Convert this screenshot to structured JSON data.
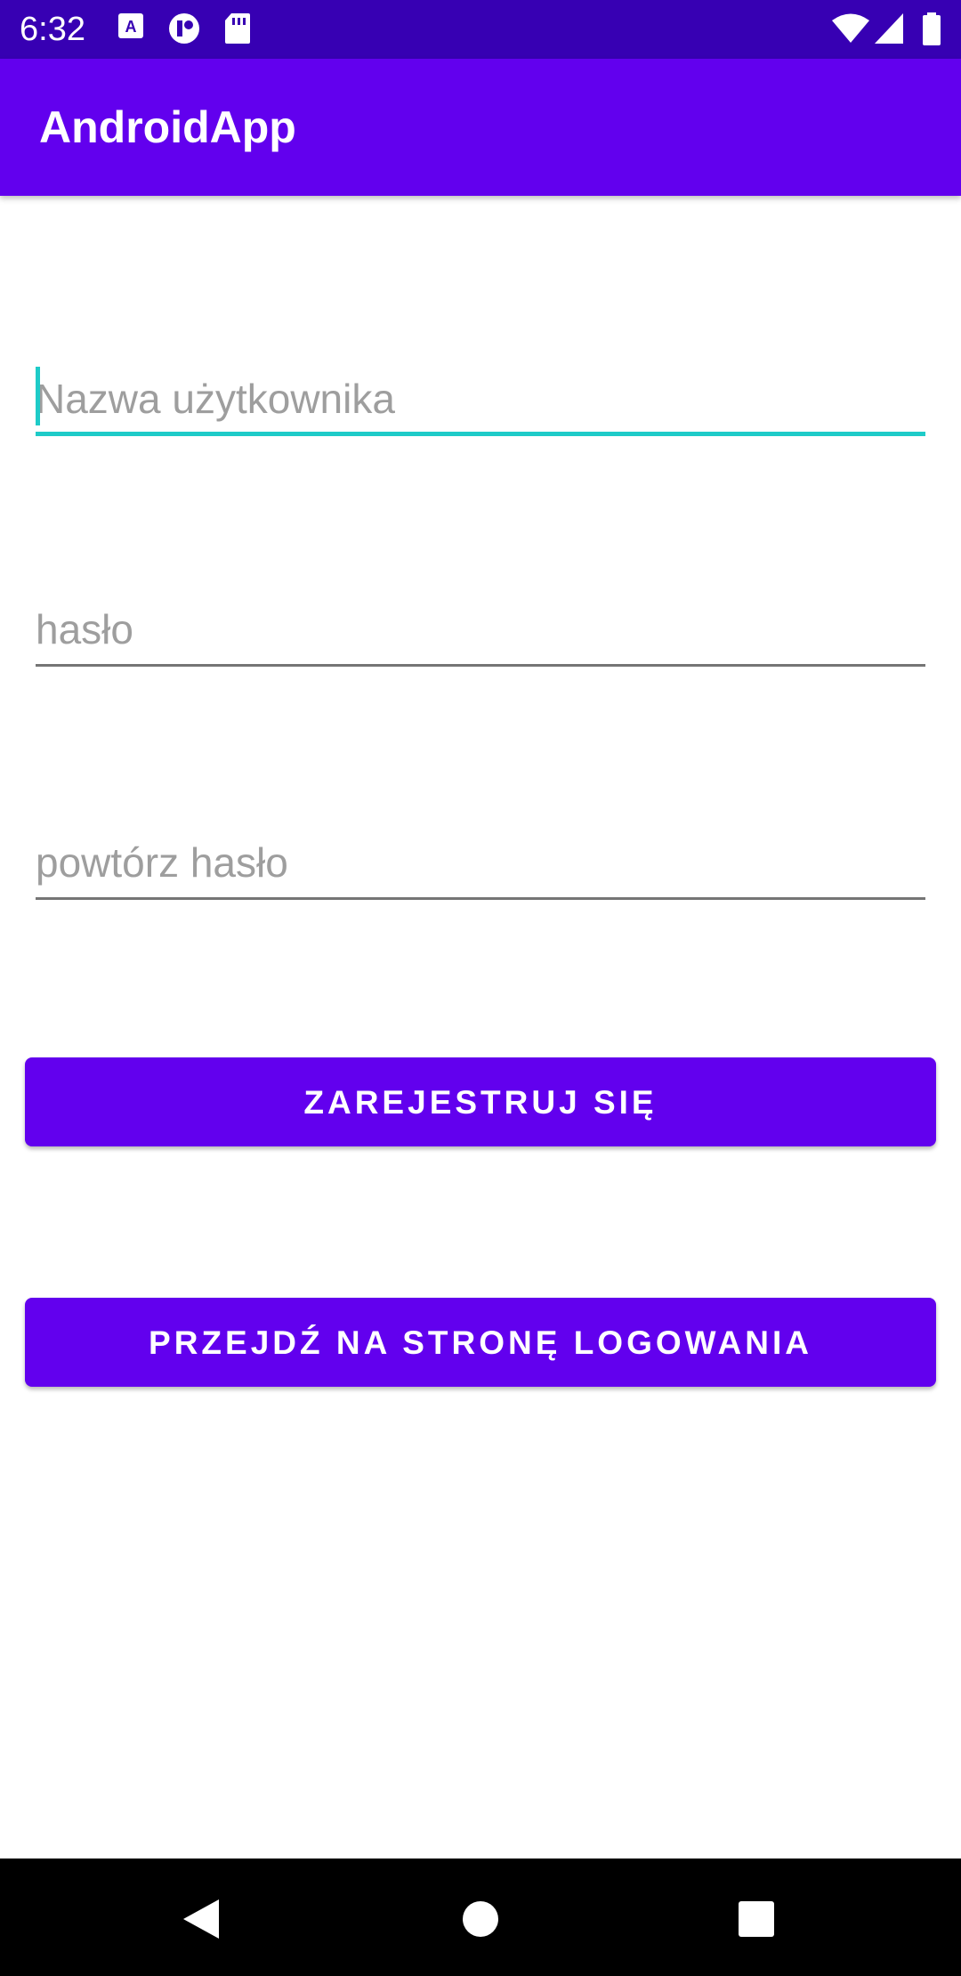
{
  "status_bar": {
    "time": "6:32",
    "icons_left": [
      "font-notification-icon",
      "app-notification-icon",
      "sd-card-icon"
    ],
    "icons_right": [
      "wifi-icon",
      "cell-signal-icon",
      "battery-icon"
    ]
  },
  "app_bar": {
    "title": "AndroidApp"
  },
  "form": {
    "username": {
      "placeholder": "Nazwa użytkownika",
      "value": ""
    },
    "password": {
      "placeholder": "hasło",
      "value": ""
    },
    "repeat_password": {
      "placeholder": "powtórz hasło",
      "value": ""
    }
  },
  "buttons": {
    "register_label": "ZAREJESTRUJ SIĘ",
    "go_to_login_label": "PRZEJDŹ NA STRONĘ LOGOWANIA"
  },
  "nav_bar": {
    "items": [
      "back-icon",
      "home-icon",
      "recents-icon"
    ]
  },
  "colors": {
    "primary": "#6200EE",
    "primary_dark": "#3700B3",
    "accent": "#03DAC5"
  }
}
